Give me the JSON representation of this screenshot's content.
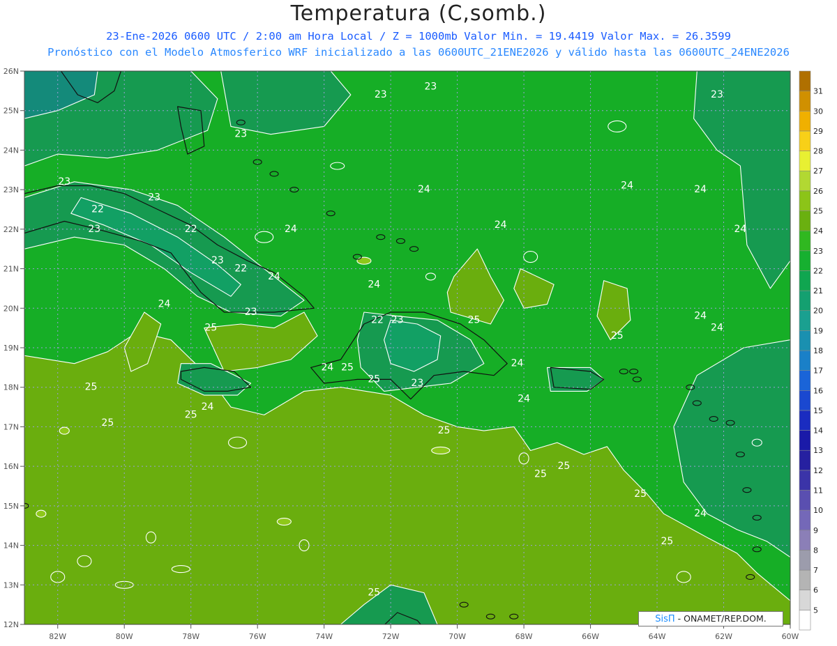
{
  "header": {
    "title": "Temperatura (C,somb.)",
    "line1": "23-Ene-2026  0600 UTC / 2:00 am Hora Local / Z = 1000mb   Valor Min. = 19.4419  Valor Max. = 26.3599",
    "line2": "Pronóstico con el Modelo Atmosferico WRF inicializado a las 0600UTC_21ENE2026 y válido hasta las  0600UTC_24ENE2026"
  },
  "map": {
    "lat_labels": [
      "26N",
      "25N",
      "24N",
      "23N",
      "22N",
      "21N",
      "20N",
      "19N",
      "18N",
      "17N",
      "16N",
      "15N",
      "14N",
      "13N",
      "12N"
    ],
    "lon_labels": [
      "82W",
      "80W",
      "78W",
      "76W",
      "74W",
      "72W",
      "70W",
      "68W",
      "66W",
      "64W",
      "62W",
      "60W"
    ],
    "lat_range": [
      12,
      26
    ],
    "lon_range": [
      -83,
      -60
    ],
    "grid": true,
    "contour_labels": [
      {
        "text": "23",
        "lon": -81.8,
        "lat": 23.2
      },
      {
        "text": "22",
        "lon": -80.8,
        "lat": 22.5
      },
      {
        "text": "23",
        "lon": -79.1,
        "lat": 22.8
      },
      {
        "text": "23",
        "lon": -80.9,
        "lat": 22.0
      },
      {
        "text": "22",
        "lon": -78.0,
        "lat": 22.0
      },
      {
        "text": "23",
        "lon": -77.2,
        "lat": 21.2
      },
      {
        "text": "22",
        "lon": -76.5,
        "lat": 21.0
      },
      {
        "text": "24",
        "lon": -75.5,
        "lat": 20.8
      },
      {
        "text": "24",
        "lon": -78.8,
        "lat": 20.1
      },
      {
        "text": "23",
        "lon": -76.2,
        "lat": 19.9
      },
      {
        "text": "25",
        "lon": -77.4,
        "lat": 19.5
      },
      {
        "text": "25",
        "lon": -81.0,
        "lat": 18.0
      },
      {
        "text": "25",
        "lon": -80.5,
        "lat": 17.1
      },
      {
        "text": "24",
        "lon": -77.5,
        "lat": 17.5
      },
      {
        "text": "25",
        "lon": -78.0,
        "lat": 17.3
      },
      {
        "text": "24",
        "lon": -75.0,
        "lat": 22.0
      },
      {
        "text": "23",
        "lon": -72.3,
        "lat": 25.4
      },
      {
        "text": "23",
        "lon": -76.5,
        "lat": 24.4
      },
      {
        "text": "24",
        "lon": -71.0,
        "lat": 23.0
      },
      {
        "text": "24",
        "lon": -72.5,
        "lat": 20.6
      },
      {
        "text": "22",
        "lon": -72.4,
        "lat": 19.7
      },
      {
        "text": "23",
        "lon": -71.8,
        "lat": 19.7
      },
      {
        "text": "24",
        "lon": -73.9,
        "lat": 18.5
      },
      {
        "text": "25",
        "lon": -73.3,
        "lat": 18.5
      },
      {
        "text": "25",
        "lon": -72.5,
        "lat": 18.2
      },
      {
        "text": "23",
        "lon": -71.2,
        "lat": 18.1
      },
      {
        "text": "24",
        "lon": -68.2,
        "lat": 18.6
      },
      {
        "text": "24",
        "lon": -68.0,
        "lat": 17.7
      },
      {
        "text": "25",
        "lon": -69.5,
        "lat": 19.7
      },
      {
        "text": "25",
        "lon": -70.4,
        "lat": 16.9
      },
      {
        "text": "25",
        "lon": -67.5,
        "lat": 15.8
      },
      {
        "text": "25",
        "lon": -66.8,
        "lat": 16.0
      },
      {
        "text": "25",
        "lon": -65.2,
        "lat": 19.3
      },
      {
        "text": "24",
        "lon": -68.7,
        "lat": 22.1
      },
      {
        "text": "23",
        "lon": -70.8,
        "lat": 25.6
      },
      {
        "text": "24",
        "lon": -64.9,
        "lat": 23.1
      },
      {
        "text": "24",
        "lon": -62.7,
        "lat": 23.0
      },
      {
        "text": "23",
        "lon": -62.2,
        "lat": 25.4
      },
      {
        "text": "24",
        "lon": -61.5,
        "lat": 22.0
      },
      {
        "text": "24",
        "lon": -62.7,
        "lat": 19.8
      },
      {
        "text": "24",
        "lon": -62.2,
        "lat": 19.5
      },
      {
        "text": "25",
        "lon": -64.5,
        "lat": 15.3
      },
      {
        "text": "24",
        "lon": -62.7,
        "lat": 14.8
      },
      {
        "text": "25",
        "lon": -63.7,
        "lat": 14.1
      },
      {
        "text": "25",
        "lon": -72.5,
        "lat": 12.8
      }
    ]
  },
  "colorbar": {
    "levels": [
      "5",
      "6",
      "7",
      "8",
      "9",
      "10",
      "11",
      "12",
      "13",
      "14",
      "15",
      "16",
      "17",
      "18",
      "19",
      "20",
      "21",
      "22",
      "23",
      "24",
      "25",
      "26",
      "27",
      "28",
      "29",
      "30",
      "31"
    ],
    "colors": [
      "#ffffff",
      "#d8d8d8",
      "#b4b4b4",
      "#9c9cac",
      "#8b7fb7",
      "#7468b8",
      "#5a4fb0",
      "#3b34a8",
      "#2620a0",
      "#1a1aa8",
      "#1a2cc0",
      "#1a48d0",
      "#1a64d8",
      "#1a80c8",
      "#1a90b0",
      "#1aa090",
      "#14a070",
      "#10a650",
      "#16b030",
      "#30b820",
      "#6ab010",
      "#8cc418",
      "#b2d832",
      "#e8f032",
      "#f8d018",
      "#f0b000",
      "#d09000",
      "#b07000"
    ]
  },
  "palette": {
    "t23": "#169a50",
    "t24": "#16ae26",
    "t25": "#6aae0e",
    "t26": "#8ec81a",
    "t22": "#12a064",
    "t21": "#148a7a",
    "coast": "#111111",
    "contour": "#ffffff",
    "gridline": "#9aa0d8"
  },
  "badge": {
    "brand": "SisΠ",
    "text": " - ONAMET/REP.DOM."
  }
}
